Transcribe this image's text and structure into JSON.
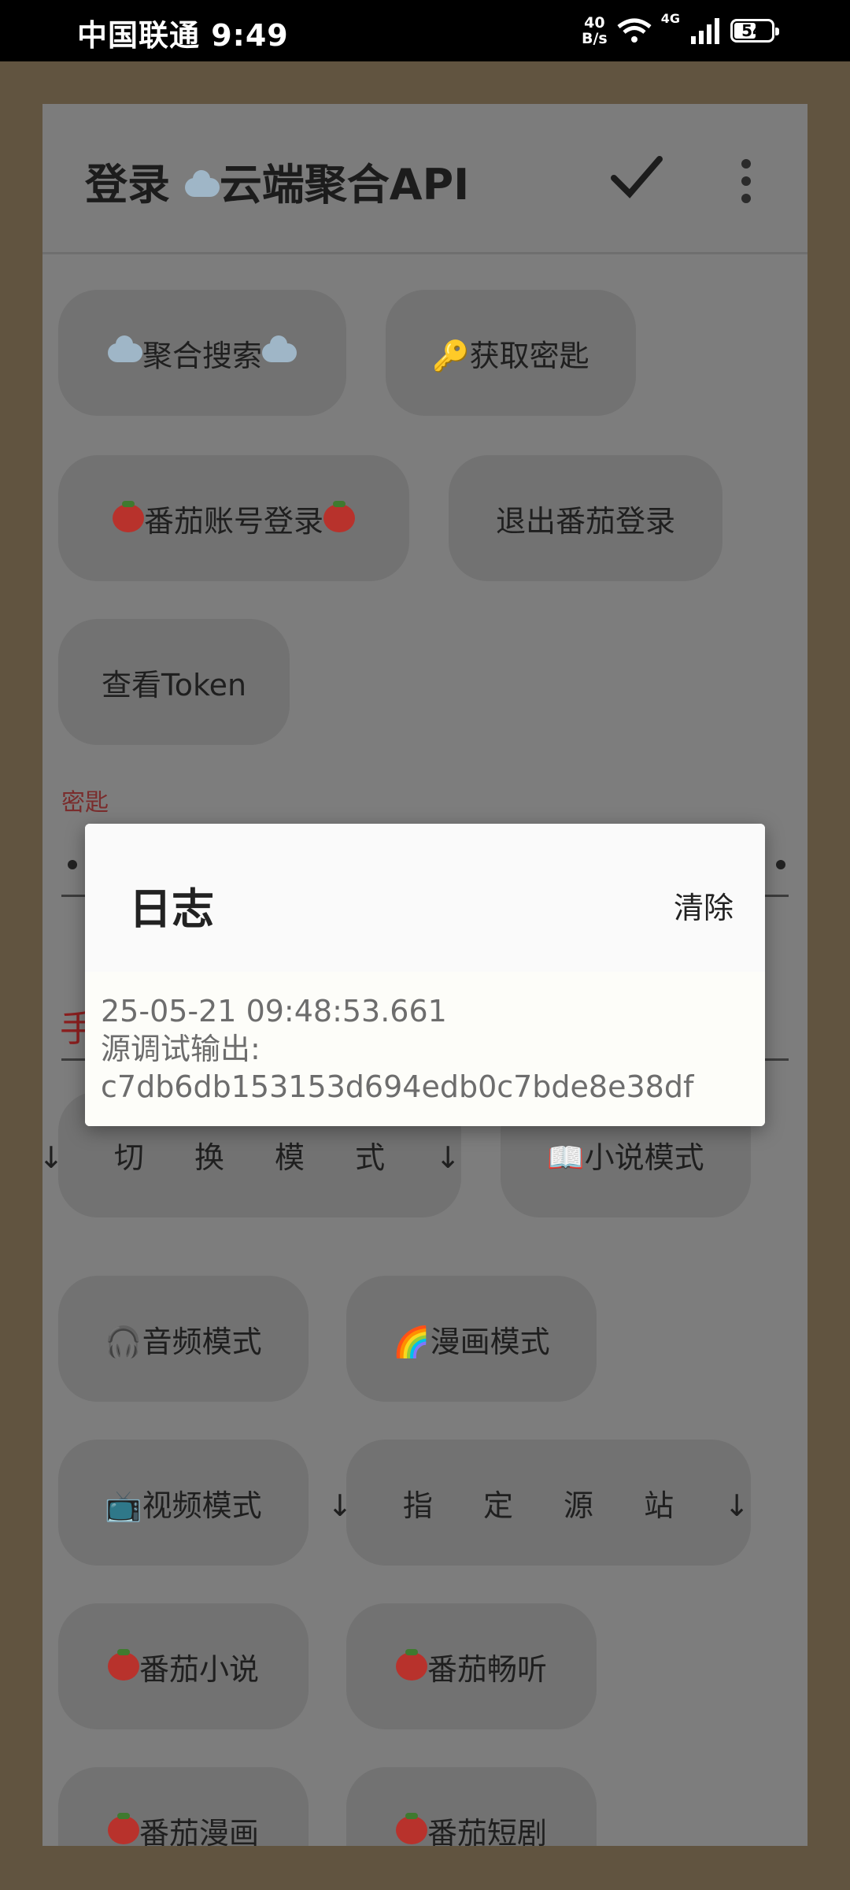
{
  "status_bar": {
    "carrier_time": "中国联通 9:49",
    "speed_value": "40",
    "speed_unit": "B/s",
    "network": "4G",
    "battery": "54"
  },
  "header": {
    "title_prefix": "登录 ",
    "title_suffix": "云端聚合API",
    "check_icon": "check-icon",
    "more_icon": "more-vertical-icon"
  },
  "buttons": {
    "aggregate_search": "聚合搜索",
    "get_key": "🔑获取密匙",
    "fanqie_login": "番茄账号登录",
    "fanqie_logout": "退出番茄登录",
    "view_token": "查看Token",
    "switch_mode": "↓ 切 换 模 式 ↓",
    "novel_mode": "📖小说模式",
    "audio_mode": "🎧音频模式",
    "comic_mode": "🌈漫画模式",
    "video_mode": "📺视频模式",
    "specify_source": "↓ 指 定 源 站 ↓",
    "fanqie_novel": "番茄小说",
    "fanqie_listen": "番茄畅听",
    "fanqie_comic": "番茄漫画",
    "fanqie_drama": "番茄短剧"
  },
  "key_field": {
    "label": "密匙"
  },
  "section_partial": "手",
  "dialog": {
    "title": "日志",
    "clear": "清除",
    "log_lines": [
      "25-05-21 09:48:53.661",
      "源调试输出:",
      "c7db6db153153d694edb0c7bde8e38df"
    ]
  },
  "colors": {
    "status_bar": "#000000",
    "dim_panel": "#7d7d7d",
    "dialog_bg": "#fafafa",
    "accent_red": "#8b1f1f"
  }
}
